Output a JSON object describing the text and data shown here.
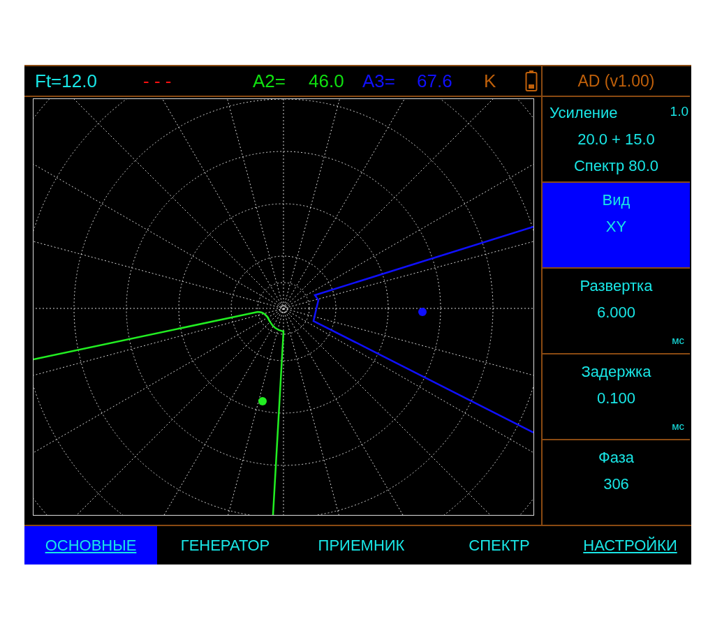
{
  "status_bar": {
    "items": [
      {
        "text": "Ft=12.0",
        "color": "#19e6e6"
      },
      {
        "text": "- - -",
        "color": "#ff1010"
      },
      {
        "text": "A2=",
        "color": "#10e010"
      },
      {
        "text": "46.0",
        "color": "#10e010"
      },
      {
        "text": "A3=",
        "color": "#1010ff"
      },
      {
        "text": "67.6",
        "color": "#1010ff"
      },
      {
        "text": "K",
        "color": "#c0600a"
      }
    ]
  },
  "side_panel": {
    "title": "AD (v1.00)",
    "sections": [
      {
        "kind": "gain",
        "label": "Усиление",
        "step": "1.0",
        "value": "20.0 + 15.0",
        "extra": "Спектр 80.0",
        "selected": false
      },
      {
        "kind": "param",
        "label": "Вид",
        "value": "XY",
        "selected": true
      },
      {
        "kind": "param",
        "label": "Развертка",
        "value": "6.000",
        "unit": "мс",
        "selected": false
      },
      {
        "kind": "param",
        "label": "Задержка",
        "value": "0.100",
        "unit": "мс",
        "selected": false
      },
      {
        "kind": "param",
        "label": "Фаза",
        "value": "306",
        "selected": false
      }
    ]
  },
  "tabs": [
    {
      "label": "ОСНОВНЫЕ",
      "selected": true,
      "underlined": true
    },
    {
      "label": "ГЕНЕРАТОР",
      "selected": false,
      "underlined": false
    },
    {
      "label": "ПРИЕМНИК",
      "selected": false,
      "underlined": false
    },
    {
      "label": "СПЕКТР",
      "selected": false,
      "underlined": false
    },
    {
      "label": "НАСТРОЙКИ",
      "selected": false,
      "underlined": true
    }
  ]
}
